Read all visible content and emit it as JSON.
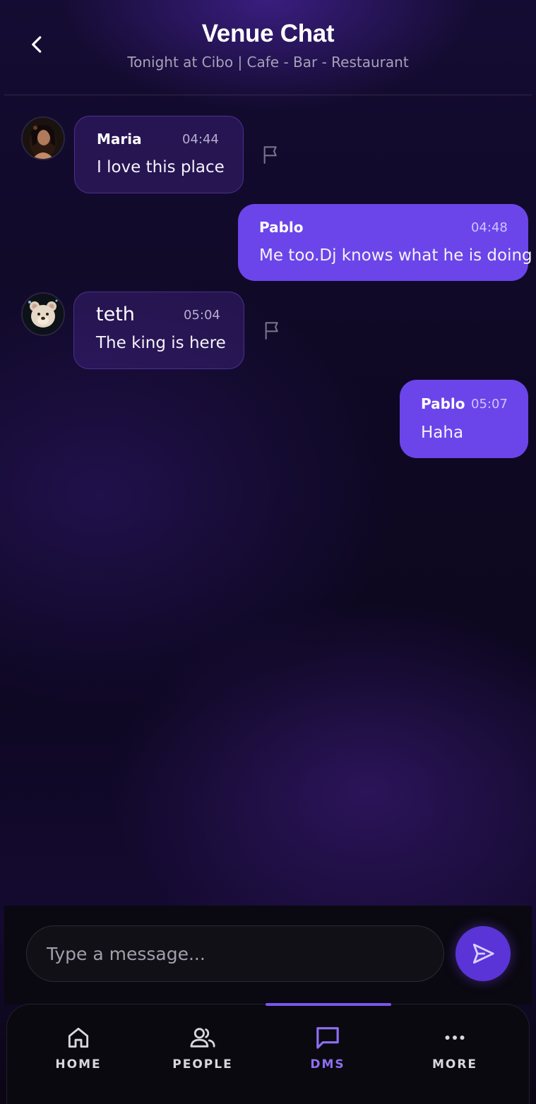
{
  "header": {
    "title": "Venue Chat",
    "subtitle": "Tonight at Cibo | Cafe - Bar - Restaurant",
    "back_icon": "chevron-left-icon"
  },
  "messages": [
    {
      "sender": "Maria",
      "time": "04:44",
      "text": "I love this place",
      "outgoing": false,
      "avatar": "avatar-maria",
      "flag_icon": "flag-icon"
    },
    {
      "sender": "Pablo",
      "time": "04:48",
      "text": "Me too.Dj knows what he is doing",
      "outgoing": true
    },
    {
      "sender": "teth",
      "time": "05:04",
      "text": "The king is here",
      "outgoing": false,
      "avatar": "avatar-teddy-bear",
      "flag_icon": "flag-icon"
    },
    {
      "sender": "Pablo",
      "time": "05:07",
      "text": "Haha",
      "outgoing": true
    }
  ],
  "composer": {
    "placeholder": "Type a message...",
    "value": "",
    "send_icon": "send-icon"
  },
  "nav": {
    "active": "DMS",
    "items": [
      {
        "label": "HOME",
        "icon": "home-icon"
      },
      {
        "label": "PEOPLE",
        "icon": "people-icon"
      },
      {
        "label": "DMS",
        "icon": "chat-bubble-icon"
      },
      {
        "label": "MORE",
        "icon": "more-dots-icon"
      }
    ]
  },
  "colors": {
    "accent": "#6b45ea",
    "active_nav": "#8e6ff2",
    "background": "#0e0822"
  }
}
